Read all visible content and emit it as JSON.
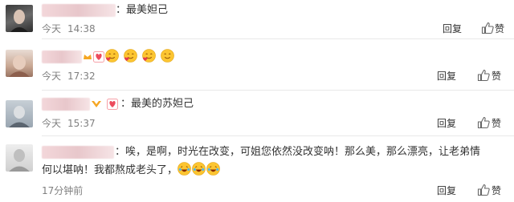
{
  "comments": [
    {
      "text": "：最美妲己",
      "date": "今天",
      "time": "14:38",
      "reply_label": "回复",
      "like_label": "赞"
    },
    {
      "date": "今天",
      "time": "17:32",
      "reply_label": "回复",
      "like_label": "赞"
    },
    {
      "text": "：最美的苏妲己",
      "date": "今天",
      "time": "15:37",
      "reply_label": "回复",
      "like_label": "赞"
    },
    {
      "text_line1": "：唉，是啊，时光在改变，可姐您依然没改变呐！那么美，那么漂亮，让老弟情",
      "text_line2": "何以堪呐！我都熬成老头了，",
      "date": "17分钟前",
      "reply_label": "回复",
      "like_label": "赞"
    }
  ],
  "icons": {
    "like": "thumbs-up-icon",
    "smile": "smiling-face-emoji",
    "laugh": "laughing-tears-emoji",
    "vip": "vip-crown-badge",
    "heart": "heart-badge"
  }
}
